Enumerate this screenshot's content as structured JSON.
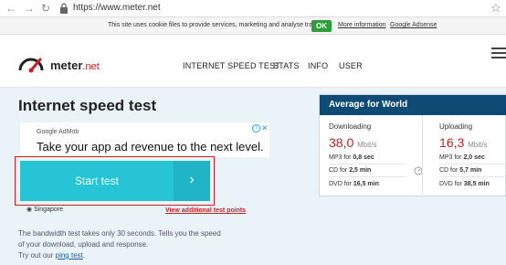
{
  "browser": {
    "back": "←",
    "forward": "→",
    "reload": "↻",
    "url": "https://www.meter.net",
    "star": "☆"
  },
  "cookie": {
    "text": "This site uses cookie files to provide services, marketing and analyse traffic.",
    "ok": "OK",
    "more_info": "More information",
    "google_adsense": "Google Adsense"
  },
  "header": {
    "logo_main": "meter",
    "logo_suffix": ".net",
    "nav": [
      "INTERNET SPEED TEST",
      "STATS",
      "INFO",
      "USER"
    ]
  },
  "main": {
    "title": "Internet speed test",
    "ad_brand": "Google AdMob",
    "ad_text": "Take your app ad revenue to the next level.",
    "start_label": "Start test",
    "start_arrow": "›",
    "server": "Singapore",
    "add_points": "View additional test points",
    "desc_line1": "The bandwidth test takes only 30 seconds. Tells you the speed",
    "desc_line2": "of your download, upload and response.",
    "desc_line3_prefix": "Try out our",
    "desc_link": "ping test",
    "desc_line3_suffix": "."
  },
  "avg": {
    "title": "Average for World",
    "download": {
      "label": "Downloading",
      "speed": "38,0",
      "unit": "Mbit/s",
      "mp3_label": "MP3 for",
      "mp3_value": "0,8 sec",
      "cd_label": "CD for",
      "cd_value": "2,5 min",
      "dvd_label": "DVD for",
      "dvd_value": "16,5 min"
    },
    "upload": {
      "label": "Uploading",
      "speed": "16,3",
      "unit": "Mbit/s",
      "mp3_label": "MP3 for",
      "mp3_value": "2,0 sec",
      "cd_label": "CD for",
      "cd_value": "5,7 min",
      "dvd_label": "DVD for",
      "dvd_value": "38,5 min"
    }
  },
  "colors": {
    "accent": "#27c4d6",
    "brand_red": "#c3222a",
    "panel_header": "#0e4a73",
    "ok_green": "#2e9e3a"
  }
}
